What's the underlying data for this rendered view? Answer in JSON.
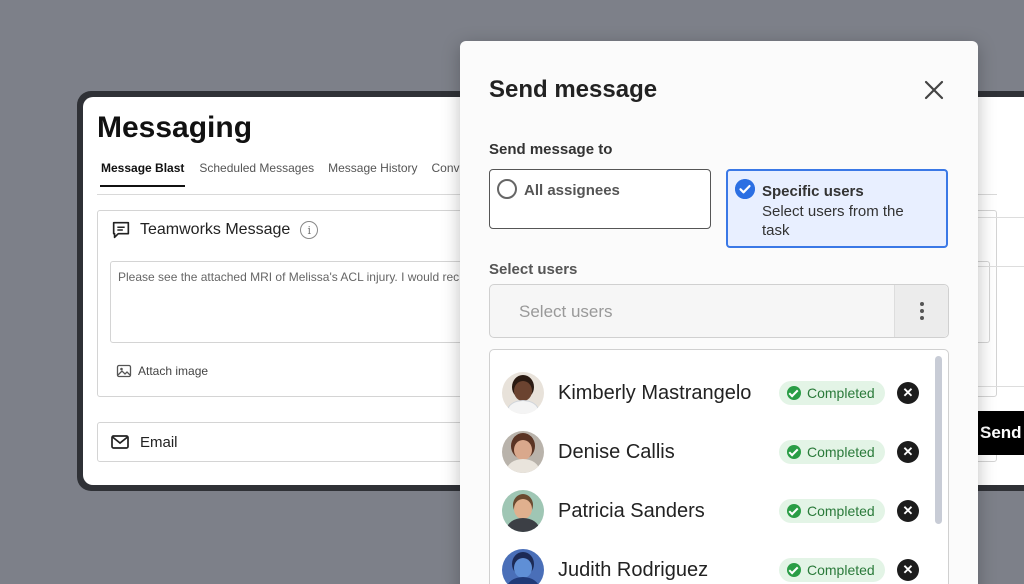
{
  "background": {
    "title": "Messaging",
    "tabs": [
      "Message Blast",
      "Scheduled Messages",
      "Message History",
      "Conv"
    ],
    "teamworks_message": {
      "label": "Teamworks Message",
      "body": "Please see the attached MRI of Melissa's ACL injury. I would rec"
    },
    "attach_label": "Attach image",
    "email_label": "Email",
    "send_label": "Send",
    "fragment_text": "e"
  },
  "modal": {
    "title": "Send message",
    "send_to_label": "Send message to",
    "options": {
      "all": {
        "label": "All assignees",
        "selected": false
      },
      "specific": {
        "label": "Specific users",
        "description": "Select users from the task",
        "selected": true
      }
    },
    "select_users_label": "Select users",
    "select_placeholder": "Select users",
    "users": [
      {
        "name": "Kimberly Mastrangelo",
        "status": "Completed"
      },
      {
        "name": "Denise Callis",
        "status": "Completed"
      },
      {
        "name": "Patricia Sanders",
        "status": "Completed"
      },
      {
        "name": "Judith Rodriguez",
        "status": "Completed"
      }
    ]
  },
  "colors": {
    "accent": "#2b6fe3",
    "status_green": "#2a9d46",
    "backdrop": "#7d8089"
  }
}
